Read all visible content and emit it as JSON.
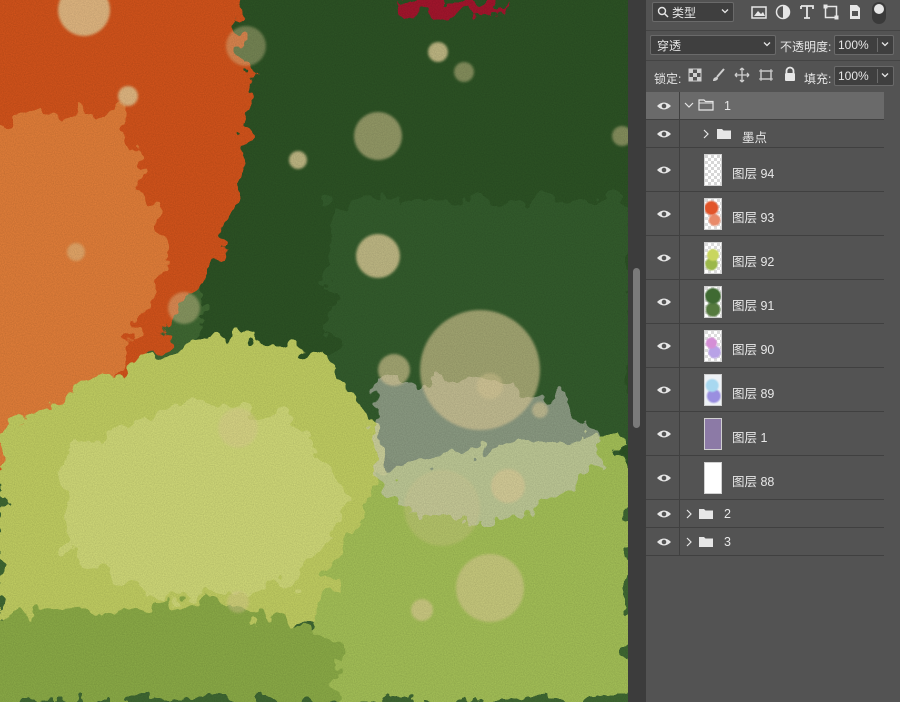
{
  "panel": {
    "filter_label": "类型",
    "blend_mode": "穿透",
    "opacity_label": "不透明度:",
    "opacity_value": "100%",
    "lock_label": "锁定:",
    "fill_label": "填充:",
    "fill_value": "100%"
  },
  "layers": [
    {
      "name": "1",
      "kind": "group-open"
    },
    {
      "name": "墨点",
      "kind": "group-closed"
    },
    {
      "name": "图层 94",
      "kind": "layer"
    },
    {
      "name": "图层 93",
      "kind": "layer"
    },
    {
      "name": "图层 92",
      "kind": "layer"
    },
    {
      "name": "图层 91",
      "kind": "layer"
    },
    {
      "name": "图层 90",
      "kind": "layer"
    },
    {
      "name": "图层 89",
      "kind": "layer"
    },
    {
      "name": "图层 1",
      "kind": "layer"
    },
    {
      "name": "图层 88",
      "kind": "layer"
    },
    {
      "name": "2",
      "kind": "group-closed"
    },
    {
      "name": "3",
      "kind": "group-closed"
    }
  ],
  "colors": {
    "panel_bg": "#535353",
    "selected_row": "#6a6a6a",
    "canvas_orange": "#d9561f",
    "canvas_dark_green": "#3f6a32",
    "canvas_light_green": "#b5cd5b",
    "layer1_fill": "#8c7aa6"
  }
}
